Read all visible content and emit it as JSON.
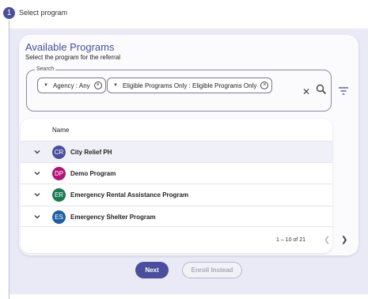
{
  "stepper": {
    "number": "1",
    "label": "Select program"
  },
  "card": {
    "title": "Available Programs",
    "subtitle": "Select the program for the referral"
  },
  "search": {
    "legend": "Search",
    "chips": [
      {
        "label": "Agency :  Any"
      },
      {
        "label": "Eligible Programs Only :  Eligible Programs Only"
      }
    ]
  },
  "table": {
    "header_name": "Name",
    "rows": [
      {
        "initials": "CR",
        "name": "City Relief PH",
        "color": "#4a4e9c"
      },
      {
        "initials": "DP",
        "name": "Demo Program",
        "color": "#b3127a"
      },
      {
        "initials": "ER",
        "name": "Emergency Rental Assistance Program",
        "color": "#1a7a52"
      },
      {
        "initials": "ES",
        "name": "Emergency Shelter Program",
        "color": "#1f5fa6"
      }
    ]
  },
  "pagination": {
    "range_text": "1 – 10 of 21"
  },
  "actions": {
    "next_label": "Next",
    "enroll_label": "Enroll Instead"
  },
  "colors": {
    "accent": "#4a4e9c",
    "content_bg": "#e9eaf6"
  }
}
